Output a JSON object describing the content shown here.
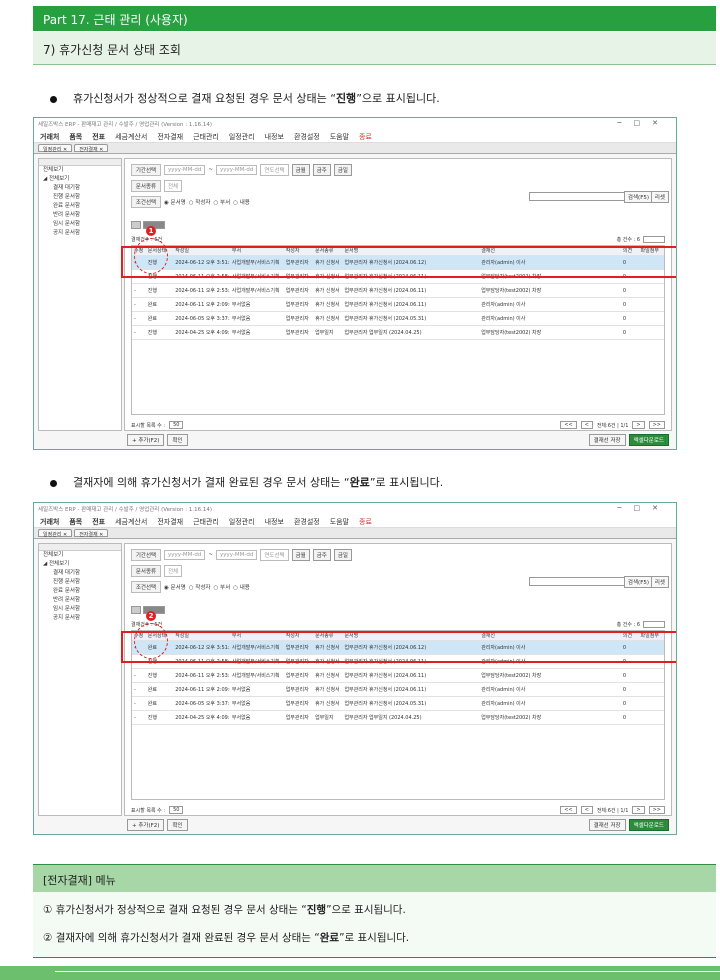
{
  "header": {
    "title": "Part 17. 근태 관리 (사용자)"
  },
  "subheader": {
    "title": "7) 휴가신청 문서 상태 조회"
  },
  "bullets": [
    {
      "pre": "휴가신청서가 정상적으로 결재 요청된 경우 문서 상태는 “",
      "strong": "진행",
      "post": "”으로 표시됩니다."
    },
    {
      "pre": "결재자에 의해 휴가신청서가 결재 완료된 경우 문서 상태는 “",
      "strong": "완료",
      "post": "”로 표시됩니다."
    }
  ],
  "app": {
    "title": "세일즈박스 ERP - 판매재고 관리 / 수발주 / 영업관리 (Version : 1.16.14)",
    "window_controls": [
      "─",
      "□",
      "✕"
    ],
    "menu": [
      "거래처",
      "품목",
      "전표",
      "세금계산서",
      "전자결재",
      "근태관리",
      "일정관리",
      "내정보",
      "환경설정",
      "도움말",
      "종료"
    ],
    "tabs": [
      "일정관리 ✕",
      "전자결재 ✕"
    ],
    "tree": [
      "전체보기",
      "전체보기",
      "결재 대기함",
      "진행 문서함",
      "완료 문서함",
      "반려 문서함",
      "임시 문서함",
      "공지 문서함"
    ],
    "filters": {
      "period_label": "기간선택",
      "date_placeholder": "yyyy-MM-dd",
      "date_sep": "~",
      "year_select": "연도선택",
      "btn_this_month": "금월",
      "btn_today": "금주",
      "btn_day": "금일",
      "doctype_label": "문서종류",
      "doctype_value": "전체",
      "cond_label": "조건선택",
      "cond_options": [
        "◉ 문서명",
        "○ 작성자",
        "○ 부서",
        "○ 내용"
      ],
      "search_btn": "검색(F5)",
      "reset_btn": "리셋"
    },
    "count_label": "결재건수 : 6건",
    "per_page_label": "총 건수 : 6",
    "columns": [
      "수정",
      "문서상태",
      "작성일",
      "부서",
      "작성자",
      "문서종류",
      "문서명",
      "결재선",
      "의견",
      "파일첨부"
    ],
    "rows_a": [
      [
        "-",
        "진행",
        "2024-06-12 오후 3:51:32",
        "사업개발부/서비스기획",
        "업무관리자",
        "휴가 신청서",
        "업무관리자 휴가신청서 (2024.06.12)",
        "관리자(admin) 이사",
        "0",
        ""
      ],
      [
        "-",
        "진행",
        "2024-06-11 오후 2:58:13",
        "사업개발부/서비스기획",
        "업무관리자",
        "휴가 신청서",
        "업무관리자 휴가신청서 (2024.06.11)",
        "업무담당자(test2002) 차장",
        "0",
        ""
      ],
      [
        "-",
        "진행",
        "2024-06-11 오후 2:53:56",
        "사업개발부/서비스기획",
        "업무관리자",
        "휴가 신청서",
        "업무관리자 휴가신청서 (2024.06.11)",
        "업무담당자(test2002) 차장",
        "0",
        ""
      ],
      [
        "-",
        "완료",
        "2024-06-11 오후 2:09:04",
        "부서없음",
        "업무관리자",
        "휴가 신청서",
        "업무관리자 휴가신청서 (2024.06.11)",
        "관리자(admin) 이사",
        "0",
        ""
      ],
      [
        "-",
        "완료",
        "2024-06-05 오후 3:37:33",
        "부서없음",
        "업무관리자",
        "휴가 신청서",
        "업무관리자 휴가신청서 (2024.05.31)",
        "관리자(admin) 이사",
        "0",
        ""
      ],
      [
        "-",
        "진행",
        "2024-04-25 오후 4:09:12",
        "부서없음",
        "업무관리자",
        "업무일지",
        "업무관리자 업무일지 (2024.04.25)",
        "업무담당자(test2002) 차장",
        "0",
        ""
      ]
    ],
    "rows_b": [
      [
        "-",
        "완료",
        "2024-06-12 오후 3:51:32",
        "사업개발부/서비스기획",
        "업무관리자",
        "휴가 신청서",
        "업무관리자 휴가신청서 (2024.06.12)",
        "관리자(admin) 이사",
        "0",
        ""
      ],
      [
        "-",
        "진행",
        "2024-06-11 오후 2:58:13",
        "사업개발부/서비스기획",
        "업무관리자",
        "휴가 신청서",
        "업무관리자 휴가신청서 (2024.06.11)",
        "관리자(admin) 이사",
        "0",
        ""
      ],
      [
        "-",
        "진행",
        "2024-06-11 오후 2:53:56",
        "사업개발부/서비스기획",
        "업무관리자",
        "휴가 신청서",
        "업무관리자 휴가신청서 (2024.06.11)",
        "업무담당자(test2002) 차장",
        "0",
        ""
      ],
      [
        "-",
        "완료",
        "2024-06-11 오후 2:09:04",
        "부서없음",
        "업무관리자",
        "휴가 신청서",
        "업무관리자 휴가신청서 (2024.06.11)",
        "관리자(admin) 이사",
        "0",
        ""
      ],
      [
        "-",
        "완료",
        "2024-06-05 오후 3:37:33",
        "부서없음",
        "업무관리자",
        "휴가 신청서",
        "업무관리자 휴가신청서 (2024.05.31)",
        "관리자(admin) 이사",
        "0",
        ""
      ],
      [
        "-",
        "진행",
        "2024-04-25 오후 4:09:12",
        "부서없음",
        "업무관리자",
        "업무일지",
        "업무관리자 업무일지 (2024.04.25)",
        "업무담당자(test2002) 차장",
        "0",
        ""
      ]
    ],
    "per_page": "표시할 목록 수 :",
    "per_page_value": "50",
    "pager_total": "전체:6건 | 1/1",
    "pager_btns": [
      "<<",
      "<",
      ">",
      ">>"
    ],
    "bottom": {
      "add": "+ 추가(F2)",
      "confirm": "확인",
      "lineset": "결재선 저장",
      "excel": "엑셀다운로드"
    },
    "markers": [
      "1",
      "2"
    ]
  },
  "summary": {
    "title": "[전자결재] 메뉴",
    "lines": [
      {
        "pre": "① 휴가신청서가 정상적으로 결재 요청된 경우 문서 상태는 “",
        "strong": "진행",
        "post": "”으로 표시됩니다."
      },
      {
        "pre": "② 결재자에 의해 휴가신청서가 결재 완료된 경우 문서 상태는 “",
        "strong": "완료",
        "post": "”로 표시됩니다."
      }
    ]
  }
}
